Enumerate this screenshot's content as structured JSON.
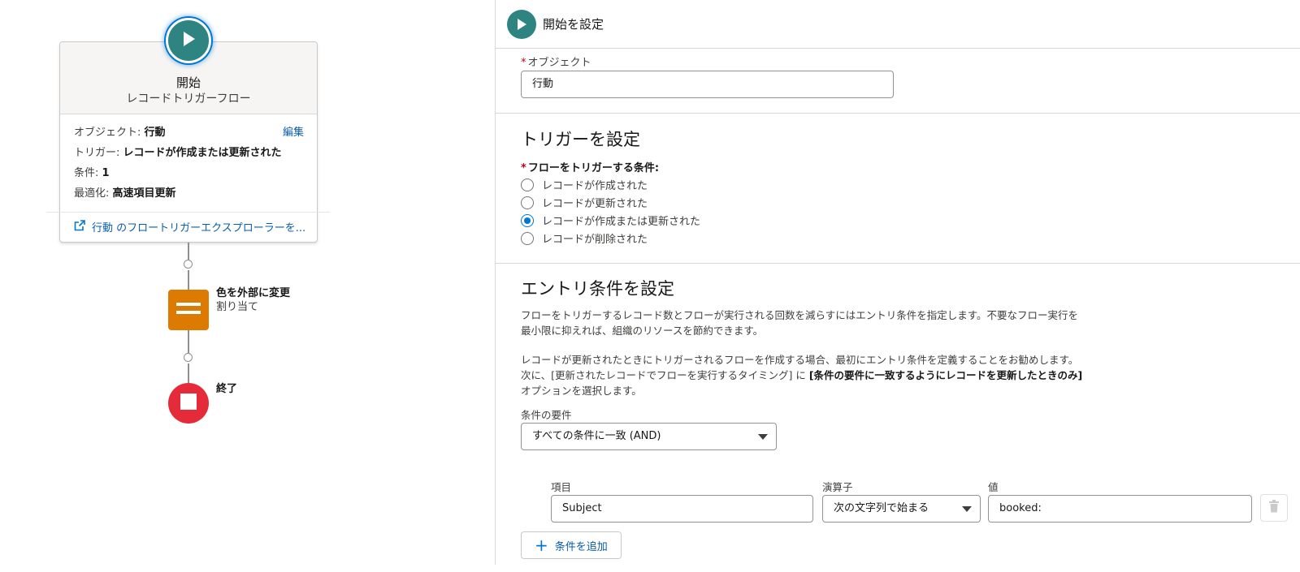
{
  "canvas": {
    "start_node": {
      "title": "開始",
      "subtitle": "レコードトリガーフロー",
      "object_label": "オブジェクト:",
      "object_value": "行動",
      "edit_link": "編集",
      "trigger_label": "トリガー:",
      "trigger_value": "レコードが作成または更新された",
      "condition_label": "条件:",
      "condition_value": "1",
      "optimize_label": "最適化:",
      "optimize_value": "高速項目更新",
      "explorer_link": "行動 のフロートリガーエクスプローラーを..."
    },
    "assignment_node": {
      "name": "色を外部に変更",
      "type": "割り当て"
    },
    "end_node": {
      "label": "終了"
    }
  },
  "panel": {
    "header_title": "開始を設定",
    "object_section": {
      "label": "オブジェクト",
      "value": "行動"
    },
    "trigger_section": {
      "title": "トリガーを設定",
      "condition_label": "フローをトリガーする条件:",
      "options": [
        {
          "label": "レコードが作成された",
          "checked": false
        },
        {
          "label": "レコードが更新された",
          "checked": false
        },
        {
          "label": "レコードが作成または更新された",
          "checked": true
        },
        {
          "label": "レコードが削除された",
          "checked": false
        }
      ]
    },
    "entry_section": {
      "title": "エントリ条件を設定",
      "desc1_line1": "フローをトリガーするレコード数とフローが実行される回数を減らすにはエントリ条件を指定します。不要なフロー実行を",
      "desc1_line2": "最小限に抑えれば、組織のリソースを節約できます。",
      "desc2_line1": "レコードが更新されたときにトリガーされるフローを作成する場合、最初にエントリ条件を定義することをお勧めします。",
      "desc2_line2_pre": "次に、[更新されたレコードでフローを実行するタイミング] に ",
      "desc2_line2_bold": "[条件の要件に一致するようにレコードを更新したときのみ]",
      "desc2_line3": "オプションを選択します。",
      "requirement_label": "条件の要件",
      "requirement_value": "すべての条件に一致 (AND)",
      "columns": {
        "field": "項目",
        "operator": "演算子",
        "value": "値"
      },
      "condition_row": {
        "field": "Subject",
        "operator": "次の文字列で始まる",
        "value": "booked:"
      },
      "add_condition_label": "条件を追加"
    }
  },
  "colors": {
    "start_teal": "#2e8481",
    "assignment_orange": "#dd7a01",
    "end_red": "#e52b3a",
    "link_blue": "#0b5cab",
    "brand_blue": "#0176d3"
  },
  "icons": {
    "start": "play-icon",
    "assignment": "equals-icon",
    "end": "stop-icon",
    "explorer": "external-link-icon",
    "delete": "trash-icon",
    "add": "plus-icon"
  }
}
